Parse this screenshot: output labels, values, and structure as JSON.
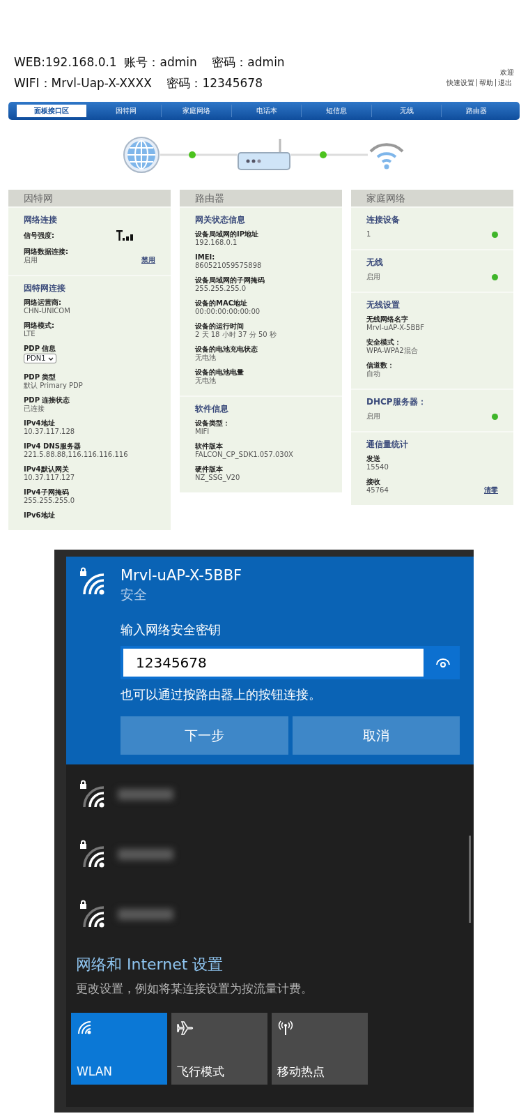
{
  "header": {
    "lines": [
      "WEB:192.168.0.1  账号：admin    密码：admin",
      "WIFI：Mrvl-Uap-X-XXXX    密码：12345678"
    ],
    "welcome": "欢迎",
    "links": [
      "快速设置",
      "帮助",
      "退出"
    ]
  },
  "nav": [
    {
      "label": "面板接口区",
      "selected": true
    },
    {
      "label": "因特网",
      "selected": false
    },
    {
      "label": "家庭网络",
      "selected": false
    },
    {
      "label": "电话本",
      "selected": false
    },
    {
      "label": "短信息",
      "selected": false
    },
    {
      "label": "无线",
      "selected": false
    },
    {
      "label": "路由器",
      "selected": false
    }
  ],
  "panels": [
    {
      "title": "因特网",
      "sections": [
        {
          "heading": "网络连接",
          "items": [
            {
              "kind": "signal",
              "label": "信号强度:"
            },
            {
              "kind": "field",
              "label": "网络数据连接:",
              "value": "启用",
              "action": "禁用"
            }
          ]
        },
        {
          "heading": "因特网连接",
          "items": [
            {
              "kind": "field",
              "label": "网络运营商:",
              "value": "CHN-UNICOM"
            },
            {
              "kind": "field",
              "label": "网络模式:",
              "value": "LTE"
            },
            {
              "kind": "select",
              "label": "PDP 信息",
              "value": "PDN1"
            },
            {
              "kind": "field",
              "label": "PDP 类型",
              "value": "默认 Primary PDP"
            },
            {
              "kind": "field",
              "label": "PDP 连接状态",
              "value": "已连接"
            },
            {
              "kind": "field",
              "label": "IPv4地址",
              "value": "10.37.117.128"
            },
            {
              "kind": "field",
              "label": "IPv4 DNS服务器",
              "value": "221.5.88.88,116.116.116.116"
            },
            {
              "kind": "field",
              "label": "IPv4默认网关",
              "value": "10.37.117.127"
            },
            {
              "kind": "field",
              "label": "IPv4子网掩码",
              "value": "255.255.255.0"
            },
            {
              "kind": "field",
              "label": "IPv6地址"
            }
          ]
        }
      ]
    },
    {
      "title": "路由器",
      "sections": [
        {
          "heading": "网关状态信息",
          "items": [
            {
              "kind": "field",
              "label": "设备局域网的IP地址",
              "value": "192.168.0.1"
            },
            {
              "kind": "field",
              "label": "IMEI:",
              "value": "860521059575898"
            },
            {
              "kind": "field",
              "label": "设备局域网的子网掩码",
              "value": "255.255.255.0"
            },
            {
              "kind": "field",
              "label": "设备的MAC地址",
              "value": "00:00:00:00:00:00"
            },
            {
              "kind": "field",
              "label": "设备的运行时间",
              "value": "2 天 18 小时 37 分 50 秒"
            },
            {
              "kind": "field",
              "label": "设备的电池充电状态",
              "value": "无电池"
            },
            {
              "kind": "field",
              "label": "设备的电池电量",
              "value": "无电池"
            }
          ]
        },
        {
          "heading": "软件信息",
          "items": [
            {
              "kind": "field",
              "label": "设备类型：",
              "value": "MIFI"
            },
            {
              "kind": "field",
              "label": "软件版本",
              "value": "FALCON_CP_SDK1.057.030X"
            },
            {
              "kind": "field",
              "label": "硬件版本",
              "value": "NZ_SSG_V20"
            }
          ]
        }
      ]
    },
    {
      "title": "家庭网络",
      "sections": [
        {
          "heading": "连接设备",
          "items": [
            {
              "kind": "status",
              "value": "1",
              "on": true
            }
          ]
        },
        {
          "heading": "无线",
          "items": [
            {
              "kind": "status",
              "value": "启用",
              "on": true
            }
          ]
        },
        {
          "heading": "无线设置",
          "items": [
            {
              "kind": "field",
              "label": "无线网络名字",
              "value": "Mrvl-uAP-X-5BBF"
            },
            {
              "kind": "field",
              "label": "安全模式：",
              "value": "WPA-WPA2混合"
            },
            {
              "kind": "field",
              "label": "信道数：",
              "value": "自动"
            }
          ]
        },
        {
          "heading": "DHCP服务器：",
          "items": [
            {
              "kind": "status",
              "value": "启用",
              "on": true
            }
          ]
        },
        {
          "heading": "通信量统计",
          "items": [
            {
              "kind": "field",
              "label": "发送",
              "value": "15540"
            },
            {
              "kind": "field",
              "label": "接收",
              "value": "45764",
              "action": "清零"
            }
          ]
        }
      ]
    }
  ],
  "wifi_flyout": {
    "selected_network": {
      "name": "Mrvl-uAP-X-5BBF",
      "status": "安全",
      "key_prompt": "输入网络安全密钥",
      "key_value": "12345678",
      "hint": "也可以通过按路由器上的按钮连接。",
      "buttons": [
        "下一步",
        "取消"
      ]
    },
    "other_networks": [
      {
        "secured": true
      },
      {
        "secured": true
      },
      {
        "secured": true
      }
    ],
    "settings": {
      "title": "网络和 Internet 设置",
      "description": "更改设置，例如将某连接设置为按流量计费。"
    },
    "quick_actions": [
      {
        "kind": "wlan",
        "label": "WLAN",
        "on": true
      },
      {
        "kind": "airplane",
        "label": "飞行模式",
        "on": false
      },
      {
        "kind": "hotspot",
        "label": "移动热点",
        "on": false
      }
    ]
  }
}
